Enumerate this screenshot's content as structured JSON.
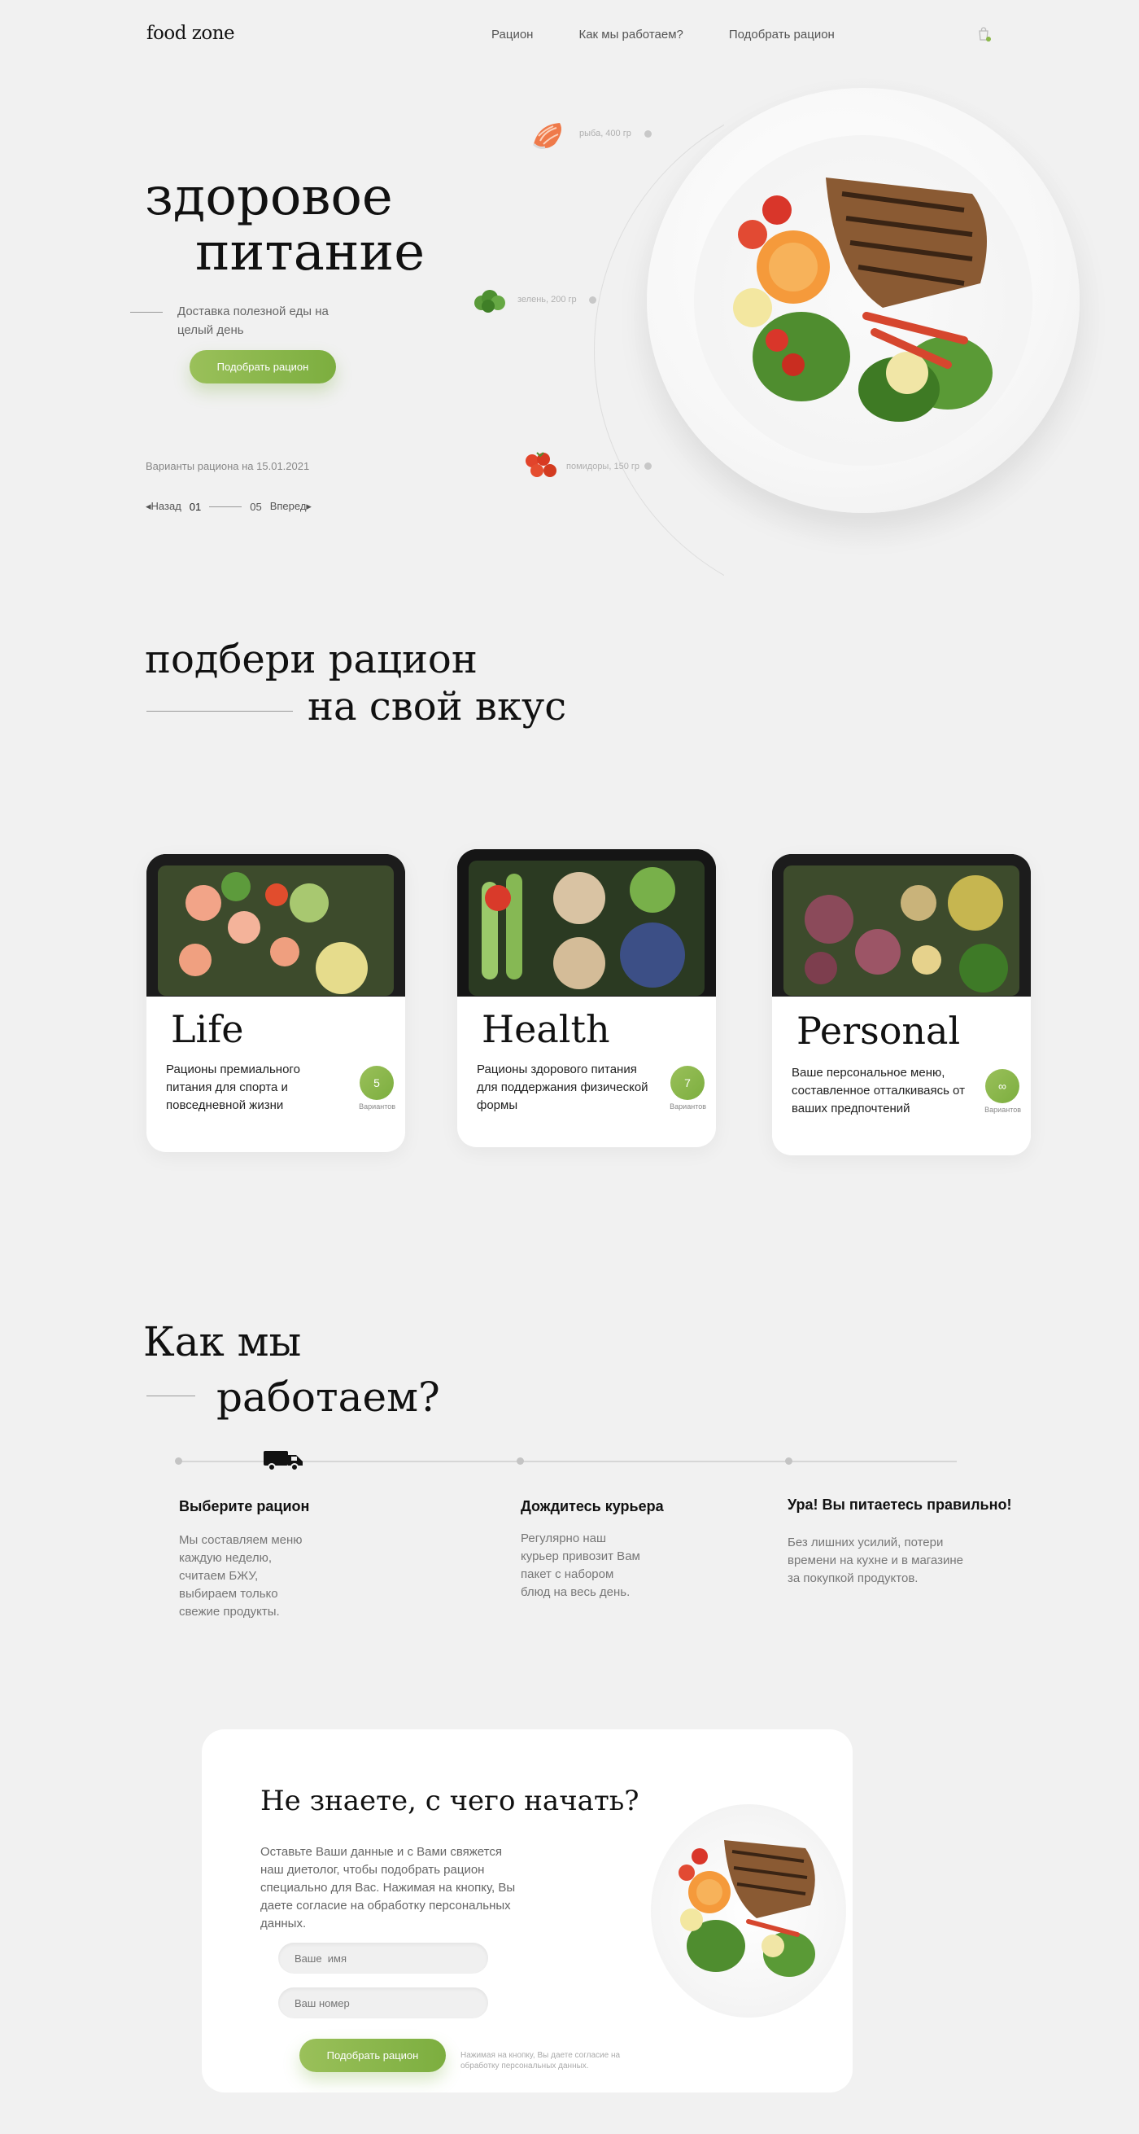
{
  "header": {
    "logo": "food zone",
    "nav": [
      "Рацион",
      "Как мы работаем?",
      "Подобрать рацион"
    ]
  },
  "hero": {
    "title_line1": "здоровое",
    "title_line2": "питание",
    "subtitle": "Доставка полезной еды на целый день",
    "button": "Подобрать рацион",
    "variants_date": "Варианты рациона на 15.01.2021",
    "pager": {
      "prev": "Назад",
      "current": "01",
      "total": "05",
      "next": "Вперед"
    },
    "ingredients": [
      {
        "label": "рыба, 400 гр",
        "icon": "salmon-icon"
      },
      {
        "label": "зелень, 200 гр",
        "icon": "greens-icon"
      },
      {
        "label": "помидоры, 150 гр",
        "icon": "tomatoes-icon"
      }
    ]
  },
  "diets": {
    "title_line1": "подбери рацион",
    "title_line2": "на свой вкус",
    "cards": [
      {
        "name": "Life",
        "desc": "Рационы премиального питания для спорта и повседневной жизни",
        "count": "5",
        "count_label": "Вариантов"
      },
      {
        "name": "Health",
        "desc": "Рационы здорового питания для поддержания физической формы",
        "count": "7",
        "count_label": "Вариантов"
      },
      {
        "name": "Personal",
        "desc": "Ваше персональное меню, составленное отталкиваясь от ваших предпочтений",
        "count": "∞",
        "count_label": "Вариантов"
      }
    ]
  },
  "how": {
    "title_line1": "Как мы",
    "title_line2": "работаем?",
    "steps": [
      {
        "title": "Выберите рацион",
        "text": "Мы составляем меню каждую неделю, считаем БЖУ, выбираем только свежие продукты."
      },
      {
        "title": "Дождитесь курьера",
        "text": "Регулярно наш курьер привозит Вам пакет с набором блюд на весь день."
      },
      {
        "title": "Ура! Вы питаетесь правильно!",
        "text": "Без лишних усилий, потери времени на кухне и в магазине за покупкой продуктов."
      }
    ]
  },
  "cta": {
    "title": "Не знаете, с чего начать?",
    "text": "Оставьте Ваши данные и с Вами свяжется наш диетолог, чтобы подобрать рацион специально для Вас. Нажимая на кнопку, Вы даете согласие на обработку персональных данных.",
    "name_placeholder": "Ваше  имя",
    "phone_placeholder": "Ваш номер",
    "button": "Подобрать рацион",
    "note": "Нажимая на кнопку, Вы даете согласие на обработку персональных данных."
  },
  "colors": {
    "accent": "#8bb84a",
    "background": "#f1f1f1"
  }
}
